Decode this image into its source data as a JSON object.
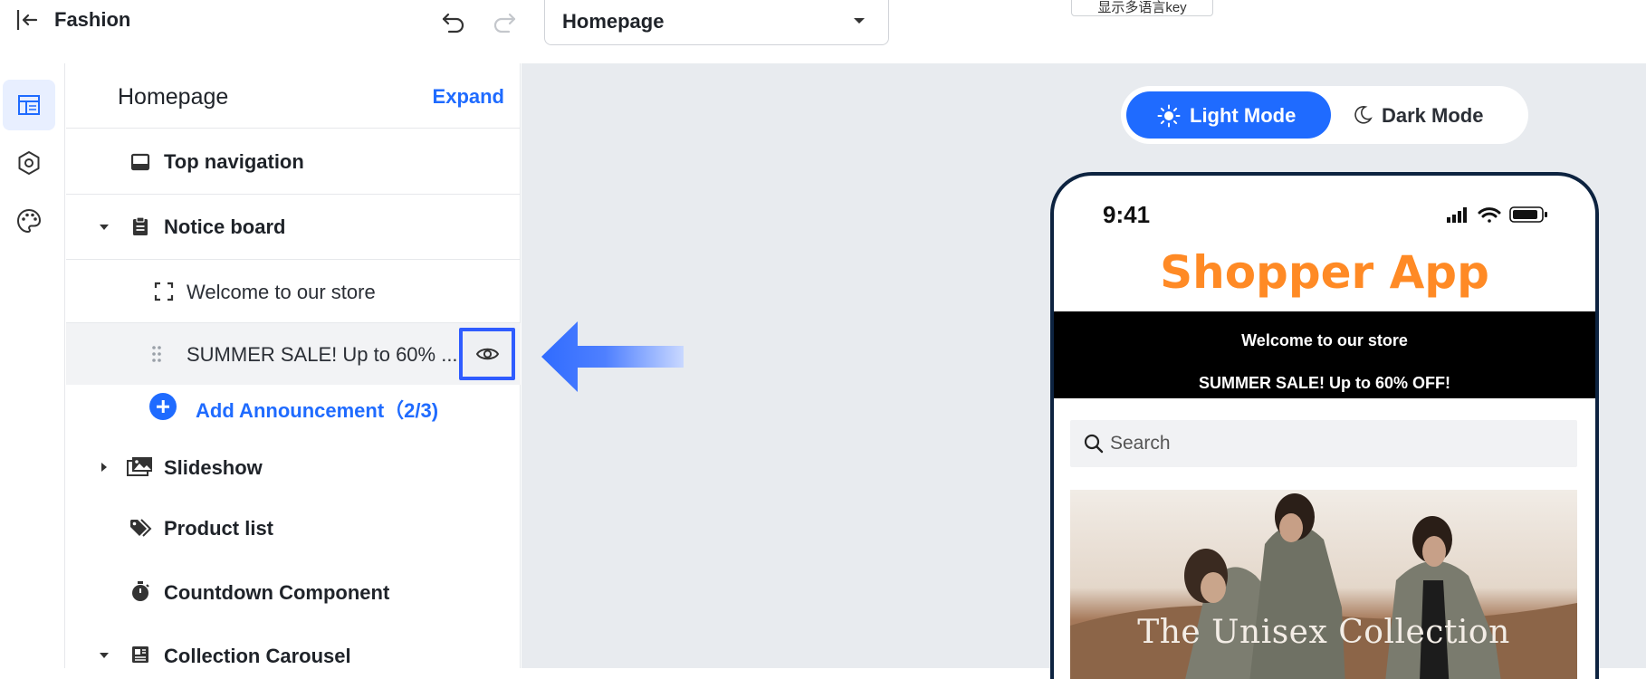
{
  "topbar": {
    "shop_name": "Fashion",
    "page_selector": {
      "selected": "Homepage"
    },
    "lang_key_button": "显示多语言key"
  },
  "rail": {
    "items": [
      {
        "name": "layout",
        "icon": "layout-icon",
        "active": true
      },
      {
        "name": "settings",
        "icon": "hexagon-settings-icon",
        "active": false
      },
      {
        "name": "theme",
        "icon": "palette-icon",
        "active": false
      }
    ]
  },
  "panel": {
    "title": "Homepage",
    "expand_label": "Expand",
    "sections": {
      "top_navigation": "Top navigation",
      "notice_board": "Notice board",
      "announcement_1": "Welcome to our store",
      "announcement_2": "SUMMER SALE! Up to 60% ...",
      "add_announcement": "Add Announcement（2/3)",
      "slideshow": "Slideshow",
      "product_list": "Product list",
      "countdown": "Countdown Component",
      "collection_carousel": "Collection Carousel"
    }
  },
  "preview": {
    "light_mode_label": "Light Mode",
    "dark_mode_label": "Dark Mode",
    "active_mode": "light",
    "phone": {
      "time": "9:41",
      "app_title": "Shopper App",
      "announcements": [
        "Welcome to our store",
        "SUMMER SALE! Up to 60% OFF!"
      ],
      "search_placeholder": "Search",
      "hero_caption": "The Unisex Collection"
    }
  },
  "colors": {
    "accent": "#1f6bff",
    "highlight_border": "#2f5cff",
    "app_title": "#ff8a25",
    "canvas_bg": "#e8ebef",
    "phone_frame": "#0d2340"
  }
}
